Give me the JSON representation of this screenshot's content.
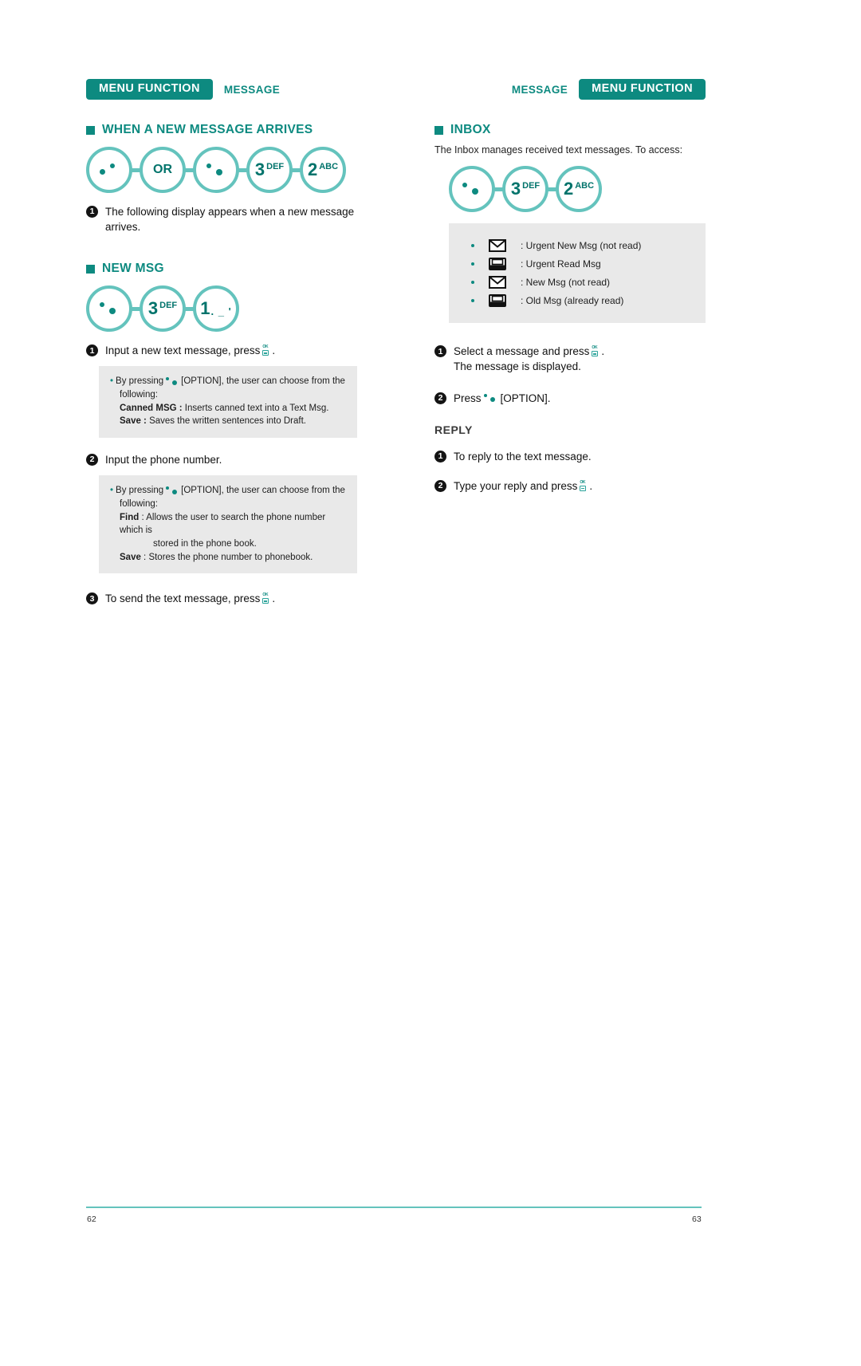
{
  "left_page": {
    "header": {
      "tag": "MENU FUNCTION",
      "sub": "MESSAGE"
    },
    "section1": {
      "title": "WHEN A NEW MESSAGE ARRIVES",
      "keys": [
        {
          "type": "dots",
          "variant": "a"
        },
        {
          "type": "text",
          "label": "OR"
        },
        {
          "type": "dots",
          "variant": "b"
        },
        {
          "type": "num",
          "num": "3",
          "sup": "DEF"
        },
        {
          "type": "num",
          "num": "2",
          "sup": "ABC"
        }
      ],
      "steps": [
        {
          "num": "1",
          "text": "The following display appears when a new message arrives."
        }
      ]
    },
    "section2": {
      "title": "NEW MSG",
      "keys": [
        {
          "type": "dots",
          "variant": "b"
        },
        {
          "type": "num",
          "num": "3",
          "sup": "DEF"
        },
        {
          "type": "num",
          "num": "1",
          "punct": ". _ '"
        }
      ],
      "step1": {
        "num": "1",
        "pre": "Input a new text message, press",
        "post": "."
      },
      "note1": {
        "lead_pre": "By pressing",
        "lead_post": "[OPTION], the user can choose from the",
        "lead_cont": "following:",
        "items": [
          {
            "term": "Canned MSG :",
            "desc": " Inserts canned text into a Text Msg."
          },
          {
            "term": "Save :",
            "desc": " Saves the written sentences into Draft."
          }
        ]
      },
      "step2": {
        "num": "2",
        "text": "Input the phone number."
      },
      "note2": {
        "lead_pre": "By pressing",
        "lead_post": "[OPTION], the user can choose from the",
        "lead_cont": "following:",
        "find_term": "Find",
        "find_desc": " : Allows the user to search the phone number which is",
        "find_cont": "stored in the phone book.",
        "save_term": "Save",
        "save_desc": " : Stores the phone number to phonebook."
      },
      "step3": {
        "num": "3",
        "pre": "To send the text message, press",
        "post": "."
      }
    },
    "page_number": "62"
  },
  "right_page": {
    "header": {
      "tag": "MENU FUNCTION",
      "sub": "MESSAGE"
    },
    "section": {
      "title": "INBOX",
      "description": "The Inbox manages received text messages. To access:",
      "keys": [
        {
          "type": "dots",
          "variant": "b"
        },
        {
          "type": "num",
          "num": "3",
          "sup": "DEF"
        },
        {
          "type": "num",
          "num": "2",
          "sup": "ABC"
        }
      ],
      "legend": [
        {
          "icon": "envelope-closed-icon",
          "label": ": Urgent New Msg (not read)"
        },
        {
          "icon": "envelope-open-icon",
          "label": ": Urgent Read Msg"
        },
        {
          "icon": "envelope-closed-icon",
          "label": ": New Msg (not read)"
        },
        {
          "icon": "envelope-open-icon",
          "label": ": Old Msg (already read)"
        }
      ],
      "step1": {
        "num": "1",
        "pre": "Select a message and press",
        "post": ".",
        "sub": "The message is displayed."
      },
      "step2": {
        "num": "2",
        "pre": "Press",
        "post": "[OPTION]."
      }
    },
    "reply": {
      "title": "REPLY",
      "step1": {
        "num": "1",
        "text": "To reply to the text message."
      },
      "step2": {
        "num": "2",
        "pre": "Type your reply and press",
        "post": "."
      }
    },
    "page_number": "63"
  },
  "colors": {
    "brand_teal": "#0d8a80",
    "key_ring": "#64c3bd",
    "note_bg": "#e9e9e9"
  }
}
